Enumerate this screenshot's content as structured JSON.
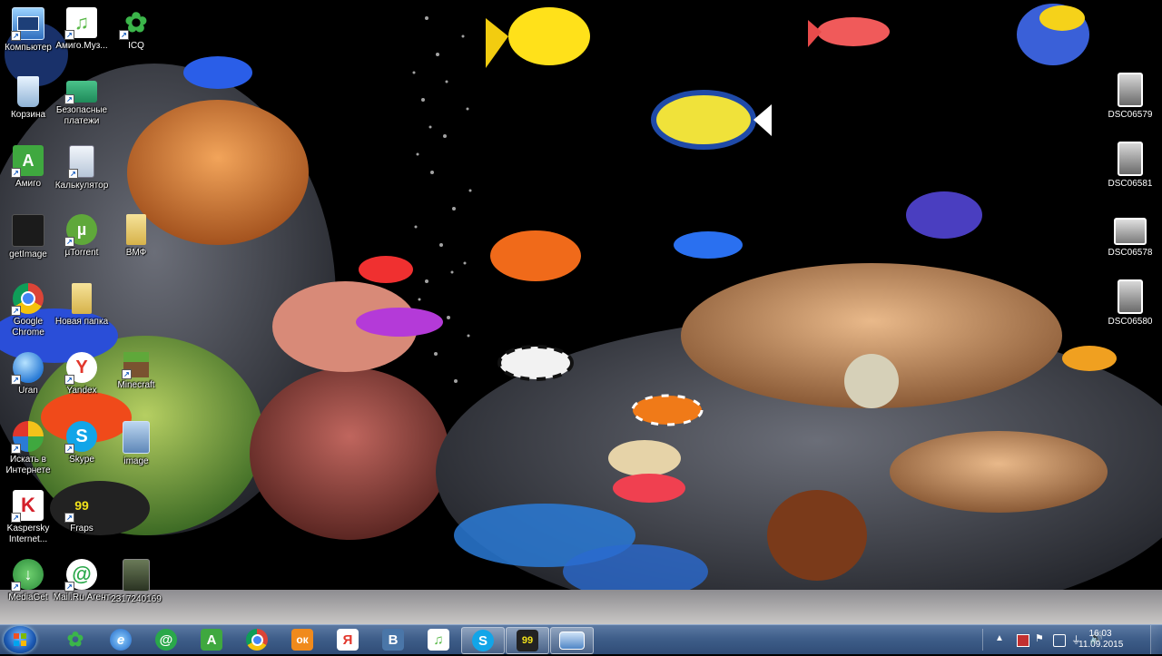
{
  "desktop": {
    "icons": [
      {
        "label": "Компьютер",
        "icon": "computer-icon"
      },
      {
        "label": "Амиго.Муз...",
        "icon": "music-icon"
      },
      {
        "label": "ICQ",
        "icon": "icq-flower-icon"
      },
      {
        "label": "Корзина",
        "icon": "recycle-bin-icon"
      },
      {
        "label": "Безопасные платежи",
        "icon": "card-icon"
      },
      {
        "label": "Амиго",
        "icon": "amigo-icon"
      },
      {
        "label": "Калькулятор",
        "icon": "calculator-icon"
      },
      {
        "label": "getImage",
        "icon": "photo-icon"
      },
      {
        "label": "µTorrent",
        "icon": "utorrent-icon"
      },
      {
        "label": "ВМФ",
        "icon": "folder-icon"
      },
      {
        "label": "Google Chrome",
        "icon": "chrome-icon"
      },
      {
        "label": "Новая папка",
        "icon": "folder-icon"
      },
      {
        "label": "Uran",
        "icon": "uran-icon"
      },
      {
        "label": "Yandex",
        "icon": "yandex-icon"
      },
      {
        "label": "Minecraft",
        "icon": "minecraft-icon"
      },
      {
        "label": "Искать в Интернете",
        "icon": "search-web-icon"
      },
      {
        "label": "Skype",
        "icon": "skype-icon"
      },
      {
        "label": "image",
        "icon": "image-icon"
      },
      {
        "label": "Kaspersky Internet...",
        "icon": "kaspersky-icon"
      },
      {
        "label": "Fraps",
        "icon": "fraps-icon"
      },
      {
        "label": "MediaGet",
        "icon": "mediaget-icon"
      },
      {
        "label": "Mail.Ru Агент",
        "icon": "mailru-agent-icon"
      },
      {
        "label": "2317240169",
        "icon": "image-icon"
      },
      {
        "label": "DSC06579",
        "icon": "photo-icon"
      },
      {
        "label": "DSC06581",
        "icon": "photo-icon"
      },
      {
        "label": "DSC06578",
        "icon": "photo-icon"
      },
      {
        "label": "DSC06580",
        "icon": "photo-icon"
      }
    ]
  },
  "taskbar": {
    "start_icon": "windows-start-icon",
    "pinned": [
      {
        "name": "icq",
        "glyph": "✿",
        "color": "#3bb54a"
      },
      {
        "name": "internet-explorer",
        "glyph": "e",
        "color": "#2a7bd6"
      },
      {
        "name": "mail-ru-agent",
        "glyph": "@",
        "color": "#2aa84a"
      },
      {
        "name": "amigo",
        "glyph": "A",
        "color": "#3fa83f"
      },
      {
        "name": "chrome",
        "glyph": "◉",
        "color": "#e0453a"
      },
      {
        "name": "odnoklassniki",
        "glyph": "ок",
        "color": "#f08a1c"
      },
      {
        "name": "yandex-browser",
        "glyph": "Я",
        "color": "#e2362b"
      },
      {
        "name": "vkontakte",
        "glyph": "В",
        "color": "#4a76a8"
      },
      {
        "name": "amigo-music",
        "glyph": "♫",
        "color": "#58b847"
      },
      {
        "name": "skype",
        "glyph": "S",
        "color": "#12a5e8"
      },
      {
        "name": "fraps",
        "glyph": "99",
        "color": "#d8c21a"
      },
      {
        "name": "image-viewer",
        "glyph": "▣",
        "color": "#4f86c6"
      }
    ],
    "clock": {
      "time": "16:03",
      "date": "11.09.2015"
    }
  }
}
